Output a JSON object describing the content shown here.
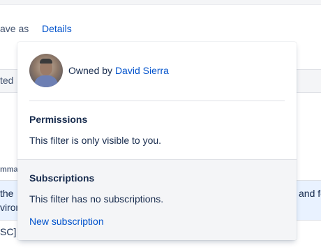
{
  "toolbar": {
    "save_as_fragment": "ave as",
    "details_label": "Details"
  },
  "background": {
    "header_fragment": "ted",
    "column_header_fragment": "mma",
    "row1_fragment": "the",
    "row1_right_fragment": "and fe",
    "row2_fragment": "viron",
    "row3_fragment": "SC] U"
  },
  "popover": {
    "owner_prefix": "Owned by",
    "owner_name": "David Sierra",
    "permissions": {
      "heading": "Permissions",
      "text": "This filter is only visible to you."
    },
    "subscriptions": {
      "heading": "Subscriptions",
      "text": "This filter has no subscriptions.",
      "new_link": "New subscription"
    }
  },
  "colors": {
    "link": "#0052cc",
    "text": "#172b4d",
    "subtle_bg": "#f4f5f7",
    "highlight_row": "#e9f2ff"
  }
}
